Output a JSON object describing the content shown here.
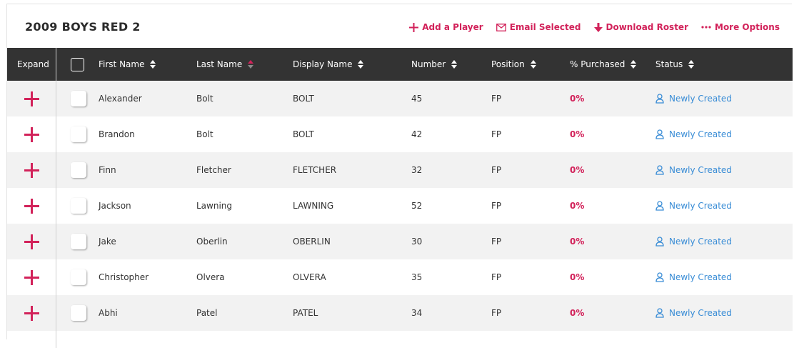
{
  "title": "2009 BOYS RED 2",
  "actions": {
    "add_player": "Add a Player",
    "email_selected": "Email Selected",
    "download_roster": "Download Roster",
    "more_options": "More Options"
  },
  "columns": {
    "expand": "Expand",
    "first_name": "First Name",
    "last_name": "Last Name",
    "display_name": "Display Name",
    "number": "Number",
    "position": "Position",
    "purchased": "% Purchased",
    "status": "Status"
  },
  "colors": {
    "accent": "#d2225a",
    "header_bg": "#333333",
    "link_blue": "#3a8dd6",
    "stripe": "#f2f2f2"
  },
  "players": [
    {
      "first": "Alexander",
      "last": "Bolt",
      "display": "BOLT",
      "number": "45",
      "position": "FP",
      "purchased": "0%",
      "status": "Newly Created"
    },
    {
      "first": "Brandon",
      "last": "Bolt",
      "display": "BOLT",
      "number": "42",
      "position": "FP",
      "purchased": "0%",
      "status": "Newly Created"
    },
    {
      "first": "Finn",
      "last": "Fletcher",
      "display": "FLETCHER",
      "number": "32",
      "position": "FP",
      "purchased": "0%",
      "status": "Newly Created"
    },
    {
      "first": "Jackson",
      "last": "Lawning",
      "display": "LAWNING",
      "number": "52",
      "position": "FP",
      "purchased": "0%",
      "status": "Newly Created"
    },
    {
      "first": "Jake",
      "last": "Oberlin",
      "display": "OBERLIN",
      "number": "30",
      "position": "FP",
      "purchased": "0%",
      "status": "Newly Created"
    },
    {
      "first": "Christopher",
      "last": "Olvera",
      "display": "OLVERA",
      "number": "35",
      "position": "FP",
      "purchased": "0%",
      "status": "Newly Created"
    },
    {
      "first": "Abhi",
      "last": "Patel",
      "display": "PATEL",
      "number": "34",
      "position": "FP",
      "purchased": "0%",
      "status": "Newly Created"
    }
  ]
}
